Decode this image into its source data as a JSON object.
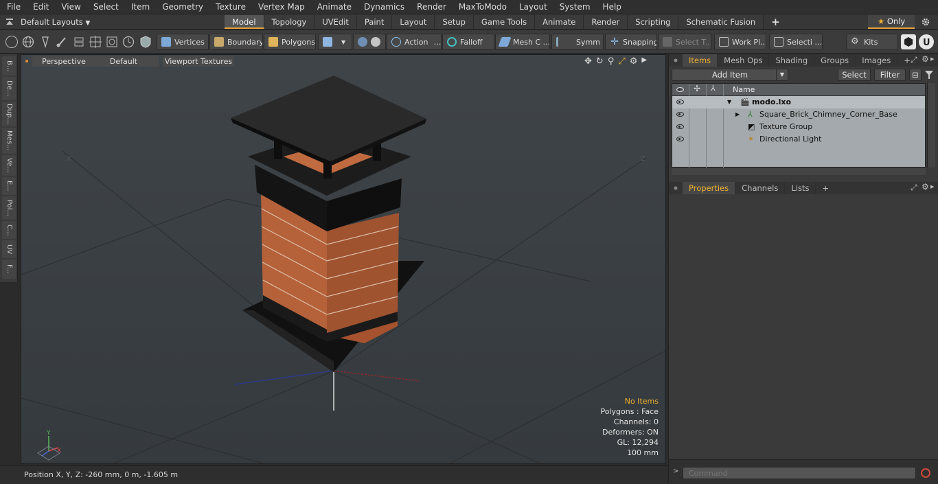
{
  "menu": [
    "File",
    "Edit",
    "View",
    "Select",
    "Item",
    "Geometry",
    "Texture",
    "Vertex Map",
    "Animate",
    "Dynamics",
    "Render",
    "MaxToModo",
    "Layout",
    "System",
    "Help"
  ],
  "layout": {
    "selector": "Default Layouts",
    "tabs": [
      "Model",
      "Topology",
      "UVEdit",
      "Paint",
      "Layout",
      "Setup",
      "Game Tools",
      "Animate",
      "Render",
      "Scripting",
      "Schematic Fusion"
    ],
    "active_tab": "Model",
    "only_label": "Only"
  },
  "toolbar": {
    "vertices": "Vertices",
    "boundary": "Boundary",
    "polygons": "Polygons",
    "action": "Action",
    "falloff": "Falloff",
    "mesh_c": "Mesh C ...",
    "symm": "Symm ...",
    "snapping": "Snapping",
    "select_t": "Select T...",
    "work_pl": "Work Pl...",
    "selecti": "Selecti ...",
    "kits": "Kits"
  },
  "left_tabs": [
    "B...",
    "De...",
    "Dup...",
    "Mes...",
    "Ve...",
    "E...",
    "Pol...",
    "C...",
    "UV",
    "F..."
  ],
  "viewport": {
    "perspective": "Perspective",
    "default": "Default",
    "textures": "Viewport Textures",
    "info": {
      "no_items": "No Items",
      "polygons": "Polygons : Face",
      "channels": "Channels: 0",
      "deformers": "Deformers: ON",
      "gl": "GL: 12,294",
      "scale": "100 mm"
    },
    "axis_x": "X",
    "axis_y": "Y",
    "axis_z": "Z"
  },
  "status": "Position X, Y, Z:   -260 mm, 0 m, -1.605 m",
  "items_panel": {
    "tabs": [
      "Items",
      "Mesh Ops",
      "Shading",
      "Groups",
      "Images"
    ],
    "active": "Items",
    "add_item": "Add Item",
    "select": "Select",
    "filter": "Filter",
    "name_header": "Name",
    "rows": [
      "modo.lxo",
      "Square_Brick_Chimney_Corner_Base",
      "Texture Group",
      "Directional Light"
    ]
  },
  "props_panel": {
    "tabs": [
      "Properties",
      "Channels",
      "Lists"
    ],
    "active": "Properties"
  },
  "command": {
    "placeholder": "Command"
  }
}
